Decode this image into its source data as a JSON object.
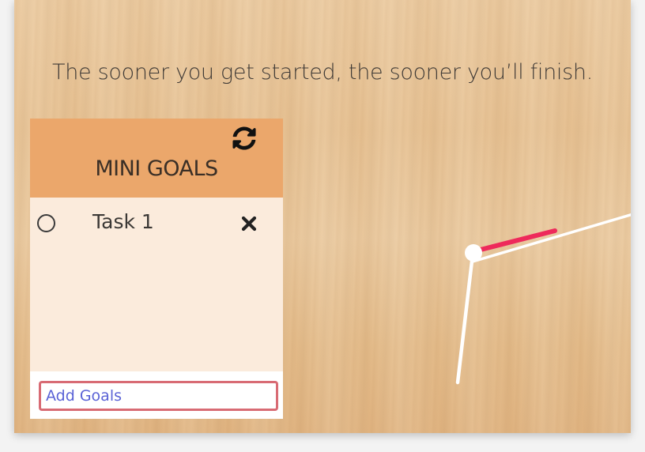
{
  "quote": "The sooner you get started, the sooner you’ll finish.",
  "goals": {
    "title": "MINI GOALS",
    "refresh_icon": "refresh-icon",
    "tasks": [
      {
        "label": "Task 1",
        "done": false
      }
    ],
    "input": {
      "placeholder": "Add Goals",
      "value": ""
    }
  },
  "clock": {
    "hand_color": "#ffffff",
    "second_hand_color": "#ee2a5b"
  }
}
